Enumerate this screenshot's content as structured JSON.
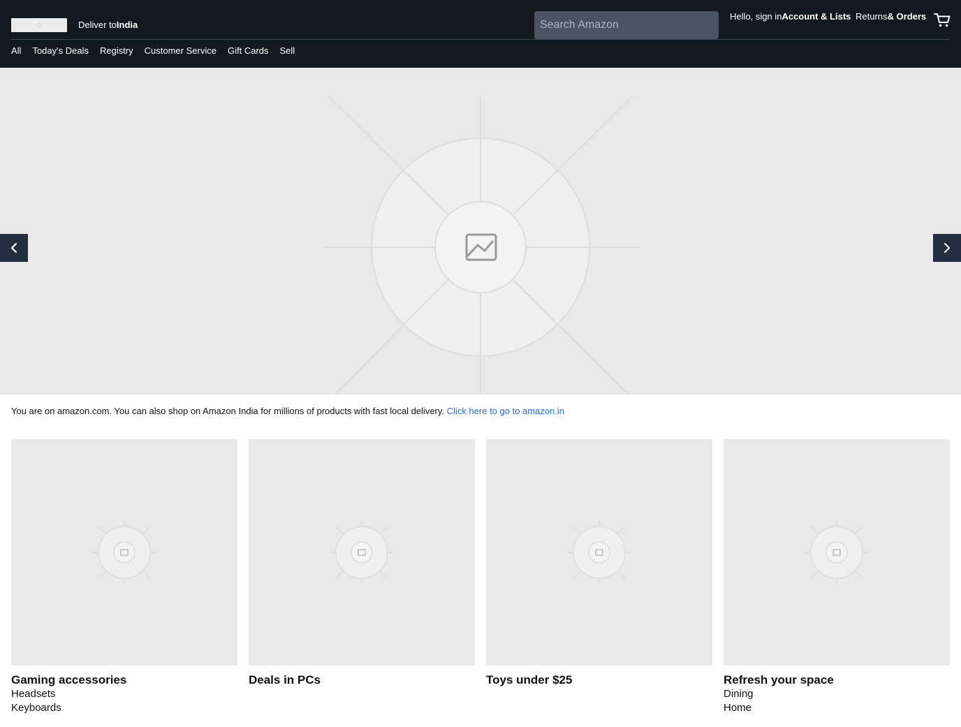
{
  "header": {
    "deliver_prefix": "Deliver to",
    "deliver_location": "India",
    "search_placeholder": "Search Amazon",
    "account_greeting": "Hello, sign in",
    "account_label": "Account & Lists",
    "returns_label": "Returns",
    "orders_label": "& Orders",
    "cart_icon": "cart-icon"
  },
  "nav": {
    "items": [
      "All",
      "Today's Deals",
      "Registry",
      "Customer Service",
      "Gift Cards",
      "Sell"
    ]
  },
  "hero": {
    "prev_icon": "chevron-left-icon",
    "next_icon": "chevron-right-icon",
    "placeholder_icon": "image-placeholder-icon"
  },
  "notice": {
    "text": "You are on amazon.com. You can also shop on Amazon India for millions of products with fast local delivery.",
    "link": "Click here to go to amazon.in"
  },
  "cards": [
    {
      "title": "Gaming accessories",
      "links": [
        "Headsets",
        "Keyboards"
      ]
    },
    {
      "title": "Deals in PCs",
      "links": []
    },
    {
      "title": "Toys under $25",
      "links": []
    },
    {
      "title": "Refresh your space",
      "links": [
        "Dining",
        "Home"
      ]
    }
  ],
  "colors": {
    "header_bg": "#131921",
    "nav_arrow_bg": "#232f3e",
    "placeholder_bg": "#e9e9e9",
    "link": "#2a6ad6"
  }
}
